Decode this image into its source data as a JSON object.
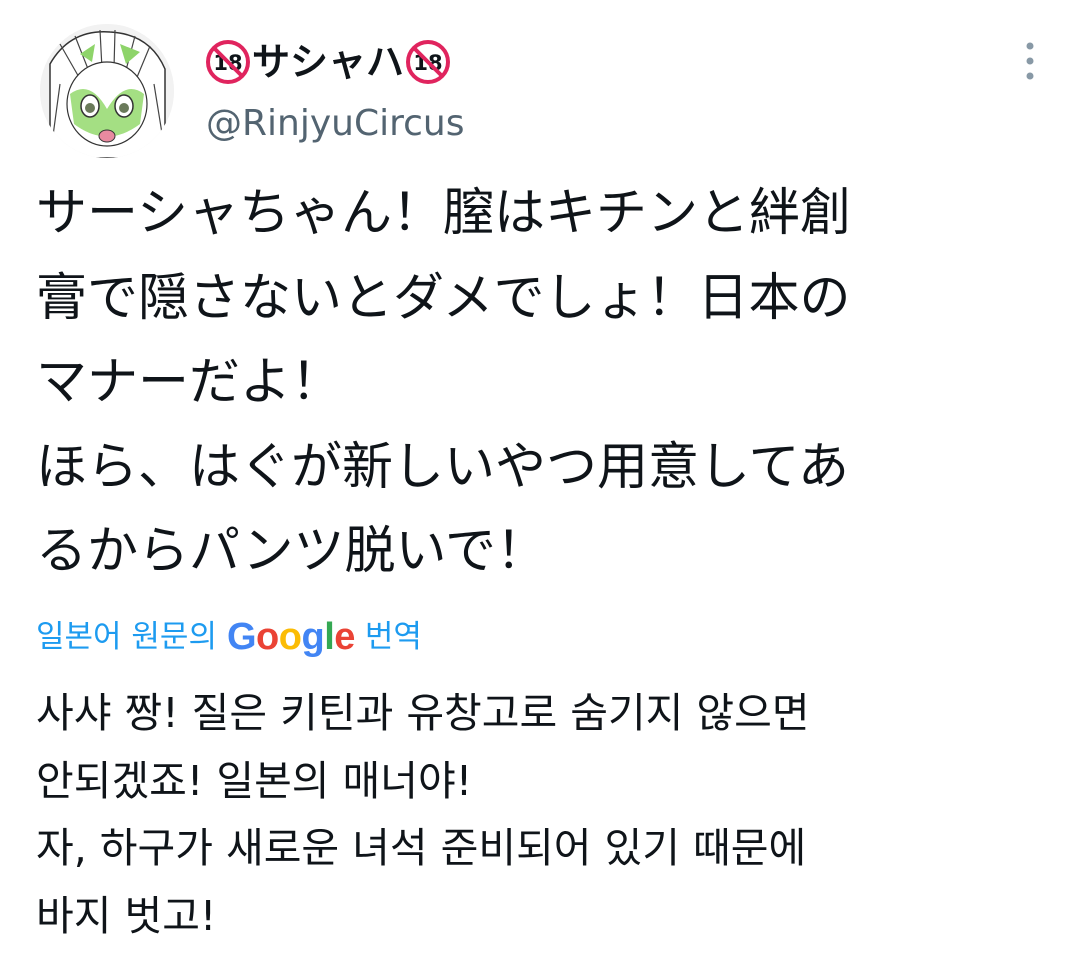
{
  "author": {
    "display_name": "サシャハ",
    "handle": "@RinjyuCircus",
    "badge_text": "18",
    "avatar_icon": "anime-avatar-icon"
  },
  "menu": {
    "icon": "more-vertical-icon"
  },
  "tweet": {
    "text": "サーシャちゃん！膣はキチンと絆創\n膏で隠さないとダメでしょ！日本の\nマナーだよ！\nほら、はぐが新しいやつ用意してあ\nるからパンツ脱いで！"
  },
  "translation": {
    "label": "일본어 원문의",
    "provider": "Google",
    "suffix": "번역",
    "text": "사샤 짱! 질은 키틴과 유창고로 숨기지 않으면\n안되겠죠! 일본의 매너야!\n자, 하구가 새로운 녀석 준비되어 있기 때문에\n바지 벗고!"
  },
  "colors": {
    "text_primary": "#0f1419",
    "text_secondary": "#536471",
    "link": "#1d9bf0",
    "badge_red": "#e0245e",
    "google_blue": "#4285f4",
    "google_red": "#ea4335",
    "google_yellow": "#fbbc05",
    "google_green": "#34a853"
  }
}
